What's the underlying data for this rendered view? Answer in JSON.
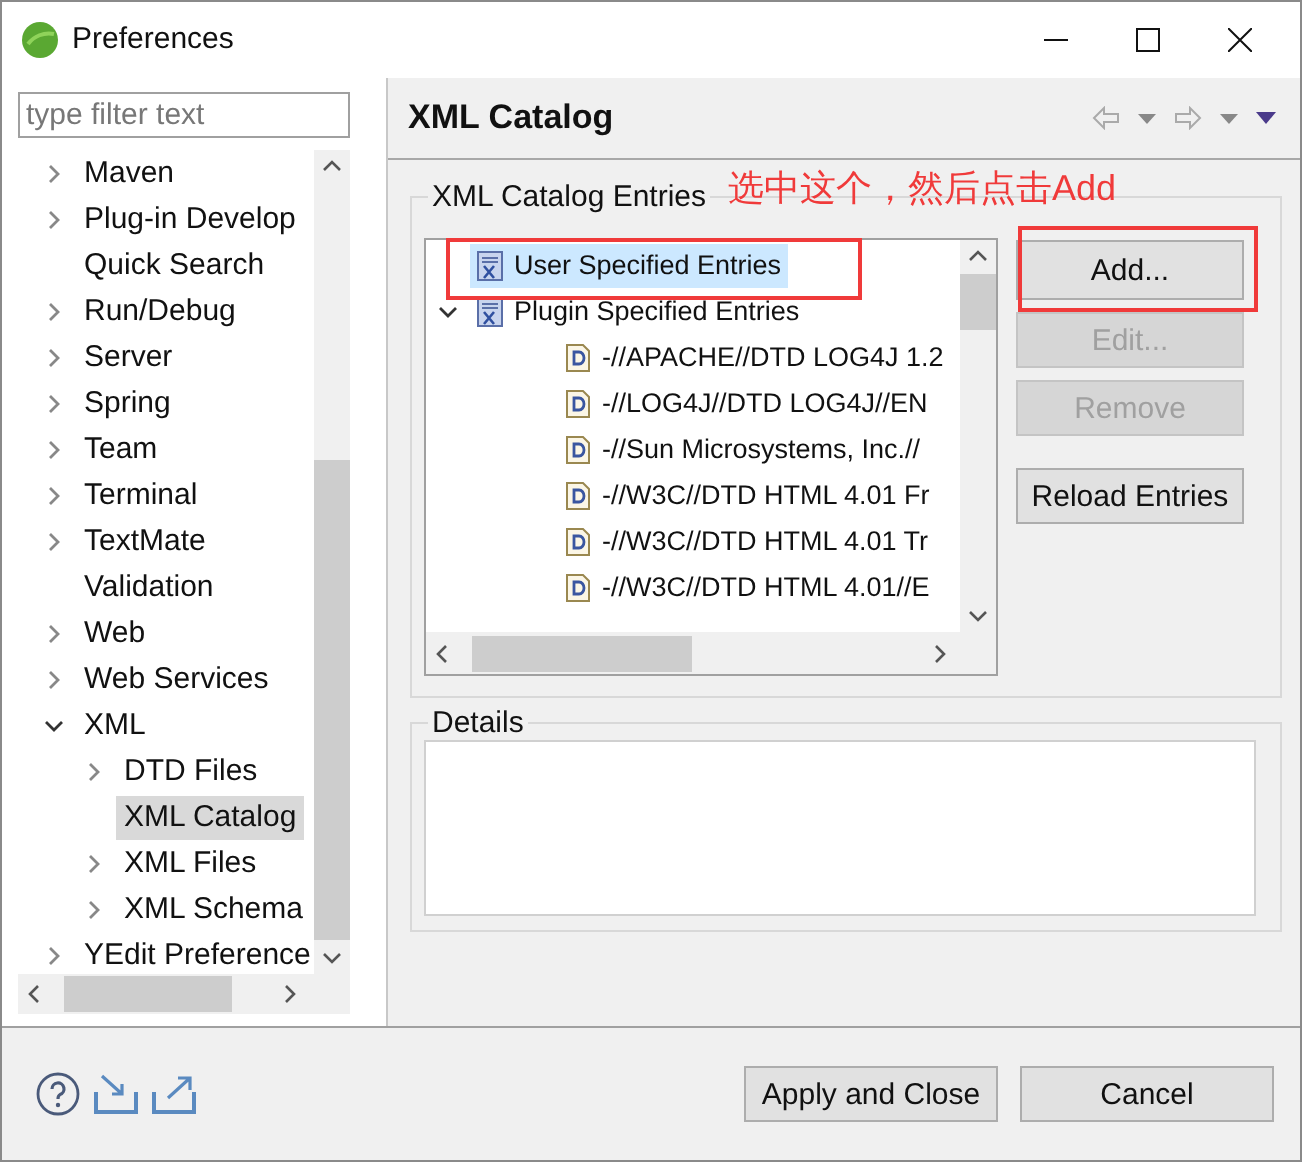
{
  "window": {
    "title": "Preferences"
  },
  "filter": {
    "placeholder": "type filter text"
  },
  "nav_tree": [
    {
      "label": "Maven",
      "expanded": false,
      "selected": false
    },
    {
      "label": "Plug-in Develop",
      "expanded": false,
      "selected": false
    },
    {
      "label": "Quick Search",
      "selected": false
    },
    {
      "label": "Run/Debug",
      "expanded": false,
      "selected": false
    },
    {
      "label": "Server",
      "expanded": false,
      "selected": false
    },
    {
      "label": "Spring",
      "expanded": false,
      "selected": false
    },
    {
      "label": "Team",
      "expanded": false,
      "selected": false
    },
    {
      "label": "Terminal",
      "expanded": false,
      "selected": false
    },
    {
      "label": "TextMate",
      "expanded": false,
      "selected": false
    },
    {
      "label": "Validation",
      "selected": false
    },
    {
      "label": "Web",
      "expanded": false,
      "selected": false
    },
    {
      "label": "Web Services",
      "expanded": false,
      "selected": false
    },
    {
      "label": "XML",
      "expanded": true,
      "selected": false,
      "children": [
        {
          "label": "DTD Files",
          "expanded": false,
          "selected": false
        },
        {
          "label": "XML Catalog",
          "selected": true
        },
        {
          "label": "XML Files",
          "expanded": false,
          "selected": false
        },
        {
          "label": "XML Schema",
          "expanded": false,
          "selected": false
        }
      ]
    },
    {
      "label": "YEdit Preference",
      "expanded": false,
      "selected": false
    }
  ],
  "page": {
    "title": "XML Catalog",
    "entries_group": {
      "label": "XML Catalog Entries",
      "entries": [
        {
          "label": "User Specified Entries",
          "kind": "catalog",
          "selected": true
        },
        {
          "label": "Plugin Specified Entries",
          "kind": "catalog",
          "expanded": true,
          "selected": false,
          "children": [
            {
              "label": "-//APACHE//DTD LOG4J 1.2",
              "kind": "dtd",
              "selected": false
            },
            {
              "label": "-//LOG4J//DTD LOG4J//EN",
              "kind": "dtd",
              "selected": false
            },
            {
              "label": "-//Sun Microsystems, Inc.//",
              "kind": "dtd",
              "selected": false
            },
            {
              "label": "-//W3C//DTD HTML 4.01 Fr",
              "kind": "dtd",
              "selected": false
            },
            {
              "label": "-//W3C//DTD HTML 4.01 Tr",
              "kind": "dtd",
              "selected": false
            },
            {
              "label": "-//W3C//DTD HTML 4.01//E",
              "kind": "dtd",
              "selected": false
            }
          ]
        }
      ],
      "buttons": [
        {
          "label": "Add...",
          "disabled": false
        },
        {
          "label": "Edit...",
          "disabled": true
        },
        {
          "label": "Remove",
          "disabled": true
        },
        {
          "label": "Reload Entries",
          "disabled": false
        }
      ]
    },
    "details_group": {
      "label": "Details"
    }
  },
  "annotation": {
    "text": "选中这个，然后点击Add"
  },
  "footer_buttons": [
    "Apply and Close",
    "Cancel"
  ]
}
